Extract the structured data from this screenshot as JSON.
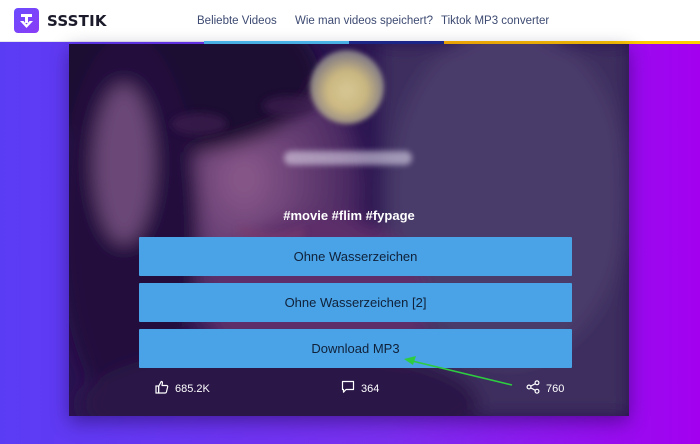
{
  "header": {
    "logo_text": "SSSTIK",
    "nav": [
      {
        "label": "Beliebte Videos"
      },
      {
        "label": "Wie man videos speichert?"
      },
      {
        "label": "Tiktok MP3 converter"
      }
    ]
  },
  "video": {
    "caption": "#movie #flim #fypage"
  },
  "buttons": [
    {
      "label": "Ohne Wasserzeichen"
    },
    {
      "label": "Ohne Wasserzeichen [2]"
    },
    {
      "label": "Download MP3"
    }
  ],
  "stats": {
    "likes": "685.2K",
    "comments": "364",
    "shares": "760"
  },
  "colors": {
    "button": "#4aa3e6",
    "background_left": "#5b3cf5",
    "background_right": "#a300f0",
    "annotation_arrow": "#2ecc40"
  },
  "icons": {
    "logo": "download-arrow-icon",
    "likes": "thumbs-up-icon",
    "comments": "comment-icon",
    "shares": "share-icon"
  }
}
